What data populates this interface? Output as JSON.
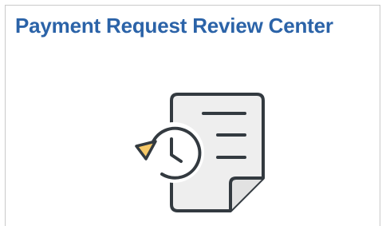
{
  "tile": {
    "title": "Payment Request Review Center",
    "icon": "document-history-icon",
    "colors": {
      "title": "#2b63a8",
      "icon_stroke": "#333a40",
      "document_fill": "#eeeeee",
      "arrow_fill": "#f6c867"
    }
  }
}
